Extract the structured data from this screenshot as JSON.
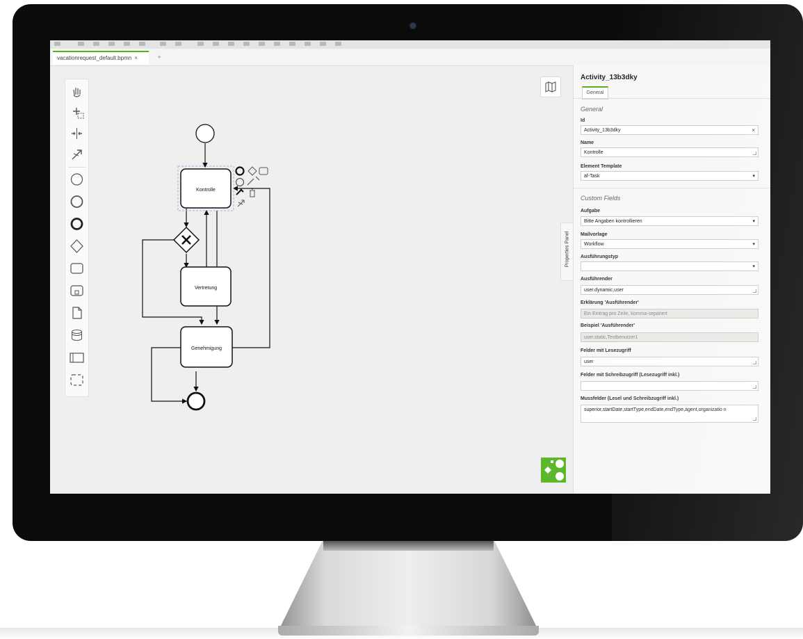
{
  "editor": {
    "tab_label": "vacationrequest_default.bpmn",
    "tab_close": "×",
    "tab_add": "+"
  },
  "palette": {
    "tools": [
      "hand-tool-icon",
      "lasso-tool-icon",
      "space-tool-icon",
      "global-connect-icon",
      "start-event-icon",
      "intermediate-event-icon",
      "end-event-icon",
      "gateway-icon",
      "task-icon",
      "subprocess-icon",
      "data-object-icon",
      "data-store-icon",
      "pool-icon",
      "group-icon"
    ]
  },
  "diagram": {
    "task_kontrolle": "Kontrolle",
    "task_vertretung": "Vertretung",
    "task_genehmigung": "Genehmigung"
  },
  "properties": {
    "panel_toggle": "Properties Panel",
    "title": "Activity_13b3dky",
    "tab_general": "General",
    "group_general": "General",
    "id_label": "Id",
    "id_value": "Activity_13b3dky",
    "clear_symbol": "×",
    "name_label": "Name",
    "name_value": "Kontrolle",
    "template_label": "Element Template",
    "template_value": "af-Task",
    "group_custom": "Custom Fields",
    "aufgabe_label": "Aufgabe",
    "aufgabe_value": "Bitte Angaben kontrollieren",
    "mailvorlage_label": "Mailvorlage",
    "mailvorlage_value": "Workflow",
    "ausfuehrungstyp_label": "Ausführungstyp",
    "ausfuehrungstyp_value": "",
    "ausfuehrender_label": "Ausführender",
    "ausfuehrender_value": "user.dynamic,user",
    "erklaerung_label": "Erklärung 'Ausführender'",
    "erklaerung_value": "Ein Eintrag pro Zeile, komma-separiert",
    "beispiel_label": "Beispiel 'Ausführender'",
    "beispiel_value": "user.static,Testbenutzer1",
    "lesezugriff_label": "Felder mit Lesezugriff",
    "lesezugriff_value": "user",
    "schreibzugriff_label": "Felder mit Schreibzugriff (Lesezugriff inkl.)",
    "schreibzugriff_value": "",
    "mussfelder_label": "Mussfelder (Lesel und Schreibzugriff inkl.)",
    "mussfelder_value": "superior,startDate,startType,endDate,endType,agent,organizatio n"
  },
  "colors": {
    "accent": "#52b415",
    "screen_bg": "#efefef",
    "bezel": "#0b0b0b"
  }
}
